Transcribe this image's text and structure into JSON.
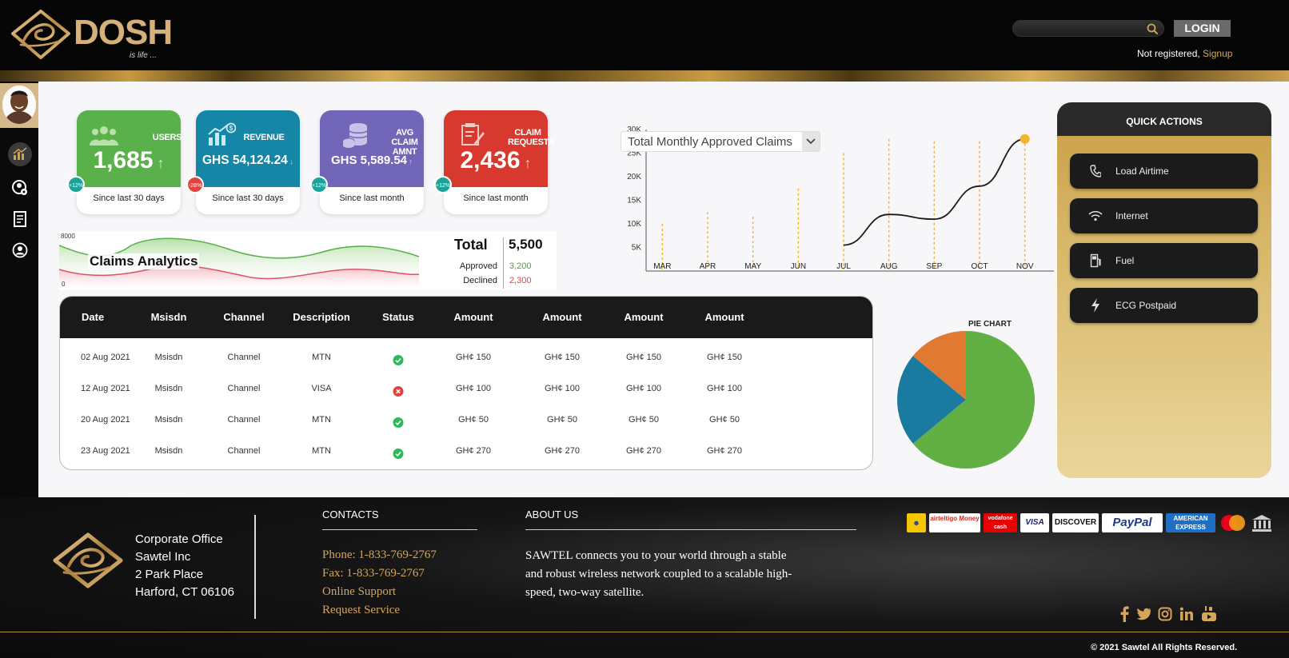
{
  "brand": {
    "name": "DOSH",
    "tagline": "is life ..."
  },
  "header": {
    "search_placeholder": "",
    "login_label": "LOGIN",
    "not_registered": "Not registered,",
    "signup_label": "Signup"
  },
  "cards": [
    {
      "label": "USERS",
      "value": "1,685",
      "arrow": "↑",
      "badge": "+12%",
      "sub": "Since last 30 days",
      "color": "#5ab04a",
      "badge_color": "#1aa39b",
      "icon": "users-icon"
    },
    {
      "label": "REVENUE",
      "value": "GHS 54,124.24",
      "arrow": "↓",
      "badge": "-28%",
      "sub": "Since last 30 days",
      "color": "#1686a6",
      "badge_color": "#e0443e",
      "icon": "revenue-chart-icon"
    },
    {
      "label": "AVG CLAIM AMNT",
      "value": "GHS 5,589.54",
      "arrow": "↑",
      "badge": "+12%",
      "sub": "Since last month",
      "color": "#7266b8",
      "badge_color": "#1aa39b",
      "icon": "coins-icon"
    },
    {
      "label": "CLAIM REQUESTS",
      "value": "2,436",
      "arrow": "↑",
      "badge": "+12%",
      "sub": "Since last month",
      "color": "#d8392e",
      "badge_color": "#1aa39b",
      "icon": "claim-form-icon"
    }
  ],
  "analytics": {
    "title": "Claims Analytics",
    "y_max": "8000",
    "y_min": "0",
    "total_label": "Total",
    "total_value": "5,500",
    "approved_label": "Approved",
    "approved_value": "3,200",
    "declined_label": "Declined",
    "declined_value": "2,300"
  },
  "chart_data": {
    "type": "line",
    "title": "Total Monthly Approved Claims",
    "categories": [
      "MAR",
      "APR",
      "MAY",
      "JUN",
      "JUL",
      "AUG",
      "SEP",
      "OCT",
      "NOV"
    ],
    "y_ticks": [
      "5K",
      "10K",
      "15K",
      "20K",
      "25K",
      "30K"
    ],
    "ylim": [
      0,
      30000
    ],
    "series": [
      {
        "values": [
          null,
          null,
          null,
          null,
          5500,
          12000,
          11000,
          18000,
          28000
        ]
      }
    ],
    "bars": [
      10000,
      12500,
      11500,
      17500,
      25000,
      28000,
      27500,
      27500,
      28000
    ],
    "colors": {
      "line": "#1a1a1a",
      "bars": "#f2b53a",
      "marker": "#f2b530"
    }
  },
  "table": {
    "headers": [
      "Date",
      "Msisdn",
      "Channel",
      "Description",
      "Status",
      "Amount",
      "Amount",
      "Amount",
      "Amount"
    ],
    "rows": [
      {
        "date": "02 Aug 2021",
        "msisdn": "Msisdn",
        "channel": "Channel",
        "desc": "MTN",
        "status": "success",
        "a1": "GH¢ 150",
        "a2": "GH¢ 150",
        "a3": "GH¢ 150",
        "a4": "GH¢ 150"
      },
      {
        "date": "12 Aug 2021",
        "msisdn": "Msisdn",
        "channel": "Channel",
        "desc": "VISA",
        "status": "failed",
        "a1": "GH¢ 100",
        "a2": "GH¢ 100",
        "a3": "GH¢ 100",
        "a4": "GH¢ 100"
      },
      {
        "date": "20 Aug 2021",
        "msisdn": "Msisdn",
        "channel": "Channel",
        "desc": "MTN",
        "status": "success",
        "a1": "GH¢ 50",
        "a2": "GH¢ 50",
        "a3": "GH¢ 50",
        "a4": "GH¢ 50"
      },
      {
        "date": "23 Aug 2021",
        "msisdn": "Msisdn",
        "channel": "Channel",
        "desc": "MTN",
        "status": "success",
        "a1": "GH¢ 270",
        "a2": "GH¢ 270",
        "a3": "GH¢ 270",
        "a4": "GH¢ 270"
      }
    ]
  },
  "pie": {
    "title": "PIE CHART",
    "slices": [
      {
        "value": 64,
        "color": "#62b043"
      },
      {
        "value": 22,
        "color": "#1a7aa0"
      },
      {
        "value": 14,
        "color": "#e07a32"
      }
    ]
  },
  "quick_actions": {
    "title": "QUICK ACTIONS",
    "items": [
      {
        "label": "Load Airtime",
        "icon": "phone-icon"
      },
      {
        "label": "Internet",
        "icon": "wifi-icon"
      },
      {
        "label": "Fuel",
        "icon": "fuel-pump-icon"
      },
      {
        "label": "ECG Postpaid",
        "icon": "lightning-icon"
      }
    ]
  },
  "footer": {
    "address": [
      "Corporate Office",
      "Sawtel Inc",
      "2 Park Place",
      "Harford, CT 06106"
    ],
    "contacts_heading": "CONTACTS",
    "phone": "Phone: 1-833-769-2767",
    "fax": "Fax: 1-833-769-2767",
    "online_support": "Online Support",
    "request_service": "Request Service",
    "about_heading": "ABOUT US",
    "about_text": "SAWTEL connects you to your world through a stable and robust wireless network coupled to a scalable high-speed, two-way satellite.",
    "payments": [
      "airteltigo Money",
      "vodafone cash",
      "VISA",
      "DISCOVER",
      "PayPal",
      "AMERICAN EXPRESS"
    ],
    "copyright": "© 2021 Sawtel All Rights Reserved."
  }
}
